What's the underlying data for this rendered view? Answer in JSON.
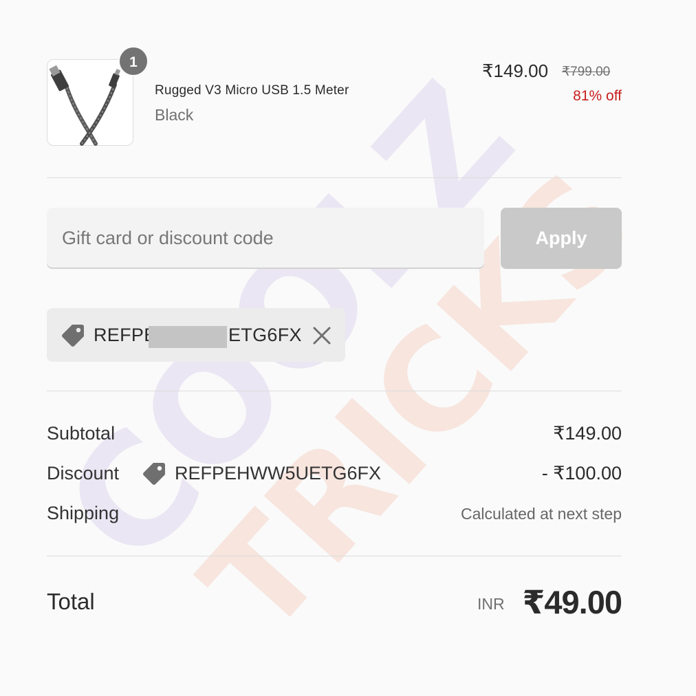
{
  "product": {
    "quantity": "1",
    "name": "Rugged V3 Micro USB 1.5 Meter",
    "variant": "Black",
    "price": "₹149.00",
    "compare_price": "₹799.00",
    "discount_percent": "81% off",
    "image_icon": "usb-cable-image"
  },
  "discount_form": {
    "placeholder": "Gift card or discount code",
    "value": "",
    "apply_label": "Apply"
  },
  "applied_code": {
    "visible_start": "REFPE",
    "visible_end": "ETG6FX",
    "icon": "tag-icon",
    "remove_icon": "close-icon"
  },
  "summary": {
    "subtotal_label": "Subtotal",
    "subtotal_value": "₹149.00",
    "discount_label": "Discount",
    "discount_code": "REFPEHWW5UETG6FX",
    "discount_value": "- ₹100.00",
    "shipping_label": "Shipping",
    "shipping_value": "Calculated at next step",
    "total_label": "Total",
    "currency": "INR",
    "total_value": "₹49.00"
  },
  "watermark": {
    "line1": "COOLZ",
    "line2": "TRICKS"
  },
  "colors": {
    "background": "#fafafa",
    "discount_red": "#c81e1e",
    "button_disabled": "#c9c9c9",
    "badge": "#737373"
  }
}
